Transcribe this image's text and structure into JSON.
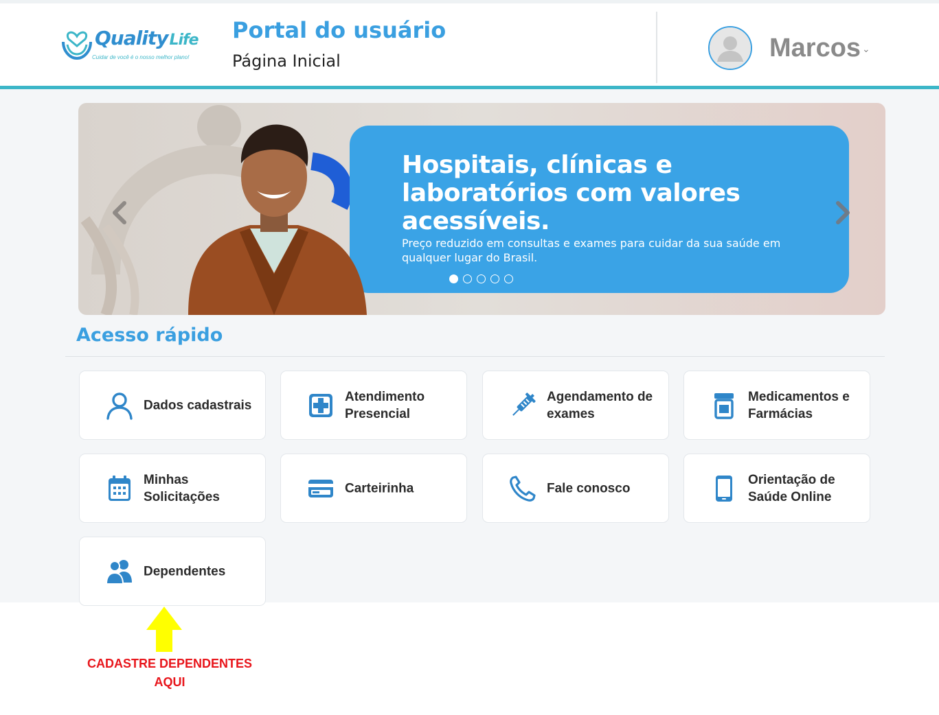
{
  "header": {
    "logo": {
      "word_main": "Quality",
      "word_sub": "Life",
      "tagline": "Cuidar de você é o nosso melhor plano!"
    },
    "title": "Portal do usuário",
    "subtitle": "Página Inicial",
    "user": {
      "name": "Marcos",
      "chevron": "⌄"
    }
  },
  "banner": {
    "headline": "Hospitais, clínicas e laboratórios com valores acessíveis.",
    "text": "Preço reduzido em consultas e exames para cuidar da sua saúde em qualquer lugar do Brasil.",
    "slide_count": 5,
    "active_slide": 1
  },
  "quick_access": {
    "title": "Acesso rápido",
    "items": [
      {
        "label": "Dados cadastrais",
        "icon": "user-icon"
      },
      {
        "label": "Atendimento Presencial",
        "icon": "medical-cross-icon"
      },
      {
        "label": "Agendamento de exames",
        "icon": "syringe-icon"
      },
      {
        "label": "Medicamentos e Farmácias",
        "icon": "pill-bottle-icon"
      },
      {
        "label": "Minhas Solicitações",
        "icon": "calendar-icon"
      },
      {
        "label": "Carteirinha",
        "icon": "card-icon"
      },
      {
        "label": "Fale conosco",
        "icon": "phone-icon"
      },
      {
        "label": "Orientação de Saúde Online",
        "icon": "mobile-icon"
      },
      {
        "label": "Dependentes",
        "icon": "users-icon"
      }
    ]
  },
  "annotation": {
    "text": "CADASTRE DEPENDENTES AQUI",
    "arrow_color": "#ffff00",
    "text_color": "#e8151b"
  },
  "colors": {
    "primary": "#3a9fe0",
    "accent": "#3cb6c8",
    "icon": "#2f86c9"
  }
}
